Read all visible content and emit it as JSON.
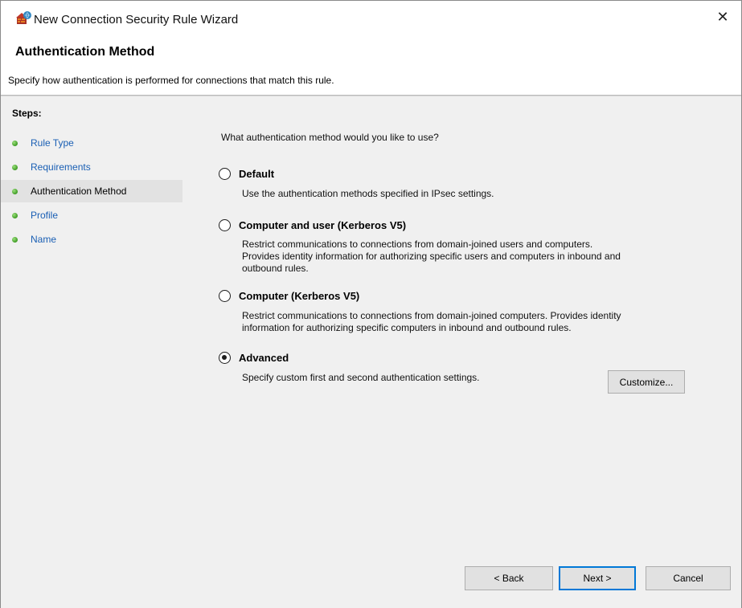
{
  "window": {
    "title": "New Connection Security Rule Wizard",
    "close_glyph": "✕"
  },
  "header": {
    "title": "Authentication Method",
    "subtitle": "Specify how authentication is performed for connections that match this rule."
  },
  "steps": {
    "label": "Steps:",
    "items": [
      {
        "label": "Rule Type",
        "current": false
      },
      {
        "label": "Requirements",
        "current": false
      },
      {
        "label": "Authentication Method",
        "current": true
      },
      {
        "label": "Profile",
        "current": false
      },
      {
        "label": "Name",
        "current": false
      }
    ]
  },
  "main": {
    "question": "What authentication method would you like to use?",
    "options": [
      {
        "label": "Default",
        "checked": false,
        "description": "Use the authentication methods specified in IPsec settings."
      },
      {
        "label": "Computer and user (Kerberos V5)",
        "checked": false,
        "description_lines": [
          "Restrict communications to connections from domain-joined users and computers.",
          "Provides identity information for authorizing specific users and computers in inbound and",
          "outbound rules."
        ]
      },
      {
        "label": "Computer (Kerberos V5)",
        "checked": false,
        "description_lines": [
          "Restrict communications to connections from domain-joined computers.  Provides identity",
          "information for authorizing specific computers in inbound and outbound rules."
        ]
      },
      {
        "label": "Advanced",
        "checked": true,
        "description": "Specify custom first and second authentication settings."
      }
    ],
    "customize_label": "Customize..."
  },
  "footer": {
    "back_label": "< Back",
    "next_label": "Next >",
    "cancel_label": "Cancel"
  },
  "icons": {
    "title_icon": "firewall-shield-icon",
    "step_bullet": "green-dot-icon"
  },
  "colors": {
    "link": "#1a5fb4",
    "panel": "#f0f0f0",
    "default_button_border": "#0078d7"
  }
}
